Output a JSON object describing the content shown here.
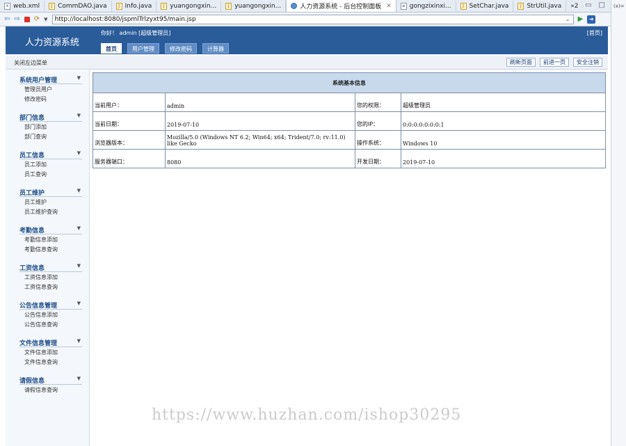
{
  "editor_tabs": [
    {
      "label": "web.xml",
      "icon": "xml-file-icon"
    },
    {
      "label": "CommDAO.java",
      "icon": "java-file-icon"
    },
    {
      "label": "Info.java",
      "icon": "java-file-icon"
    },
    {
      "label": "yuangongxin...",
      "icon": "java-file-icon"
    },
    {
      "label": "yuangongxin...",
      "icon": "java-file-icon"
    },
    {
      "label": "人力资源系统 - 后台控制面板",
      "icon": "browser-globe-icon",
      "active": true
    },
    {
      "label": "gongzixinxi...",
      "icon": "file-icon"
    },
    {
      "label": "SetChar.java",
      "icon": "java-file-icon"
    },
    {
      "label": "StrUtil.java",
      "icon": "java-file-icon"
    }
  ],
  "overflow_tabs": "»2",
  "side_panel_label": "(x)= V",
  "browser": {
    "url": "http://localhost:8080/jspmlTrlzyxt95/main.jsp"
  },
  "app": {
    "title": "人力资源系统",
    "greeting": "你好！ admin [超级管理员]",
    "home_link": "[首页]",
    "nav_tabs": [
      "首页",
      "用户管理",
      "修改密码",
      "计算器"
    ],
    "close_left_menu": "关闭左边菜单",
    "toolbar_buttons": [
      "刷新页面",
      "前进一页",
      "安全注销"
    ]
  },
  "menu": [
    {
      "title": "系统用户管理",
      "items": [
        "管理员用户",
        "修改密码"
      ]
    },
    {
      "title": "部门信息",
      "items": [
        "部门添加",
        "部门查询"
      ]
    },
    {
      "title": "员工信息",
      "items": [
        "员工添加",
        "员工查询"
      ]
    },
    {
      "title": "员工维护",
      "items": [
        "员工维护",
        "员工维护查询"
      ]
    },
    {
      "title": "考勤信息",
      "items": [
        "考勤信息添加",
        "考勤信息查询"
      ]
    },
    {
      "title": "工资信息",
      "items": [
        "工资信息添加",
        "工资信息查询"
      ]
    },
    {
      "title": "公告信息管理",
      "items": [
        "公告信息添加",
        "公告信息查询"
      ]
    },
    {
      "title": "文件信息管理",
      "items": [
        "文件信息添加",
        "文件信息查询"
      ]
    },
    {
      "title": "请假信息",
      "items": [
        "请假信息查询"
      ]
    }
  ],
  "info": {
    "header": "系统基本信息",
    "rows": [
      [
        "当前用户：",
        "admin",
        "您的权限：",
        "超级管理员"
      ],
      [
        "当前日期：",
        "2019-07-10",
        "您的IP：",
        "0:0:0:0:0:0:0:1"
      ],
      [
        "浏览器版本：",
        "Mozilla/5.0 (Windows NT 6.2; Win64; x64; Trident/7.0; rv:11.0) like Gecko",
        "操作系统：",
        "Windows 10"
      ],
      [
        "服务器端口：",
        "8080",
        "开发日期：",
        "2019-07-10"
      ]
    ]
  },
  "watermark": "https://www.huzhan.com/ishop30295"
}
